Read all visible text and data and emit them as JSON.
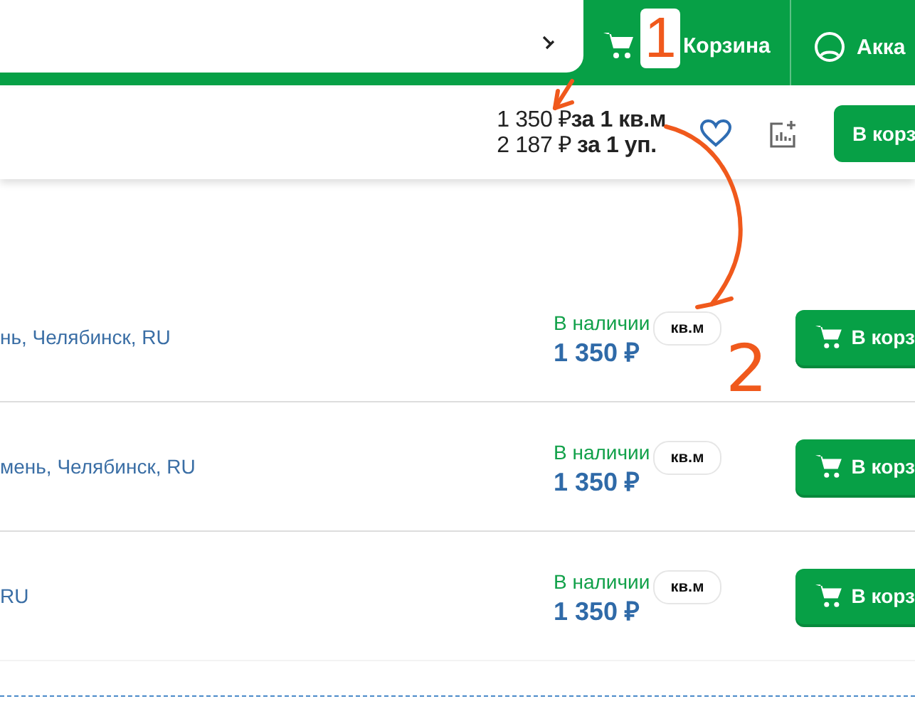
{
  "header": {
    "cart_label": "Корзина",
    "account_label": "Акка"
  },
  "product_bar": {
    "price_per_unit": "1 350 ₽**за 1 кв.м**",
    "price_per_pack": "2 187 ₽ **за 1 уп.**",
    "button": "В корз"
  },
  "offers": [
    {
      "location": "нь, Челябинск, RU",
      "stock": "В наличии",
      "price": "1 350 ₽",
      "unit": "кв.м",
      "button": "В корз"
    },
    {
      "location": "мень, Челябинск, RU",
      "stock": "В наличии",
      "price": "1 350 ₽",
      "unit": "кв.м",
      "button": "В корз"
    },
    {
      "location": "RU",
      "stock": "В наличии",
      "price": "1 350 ₽",
      "unit": "кв.м",
      "button": "В корз"
    }
  ],
  "annotations": [
    {
      "label": "1"
    },
    {
      "label": "2"
    }
  ]
}
